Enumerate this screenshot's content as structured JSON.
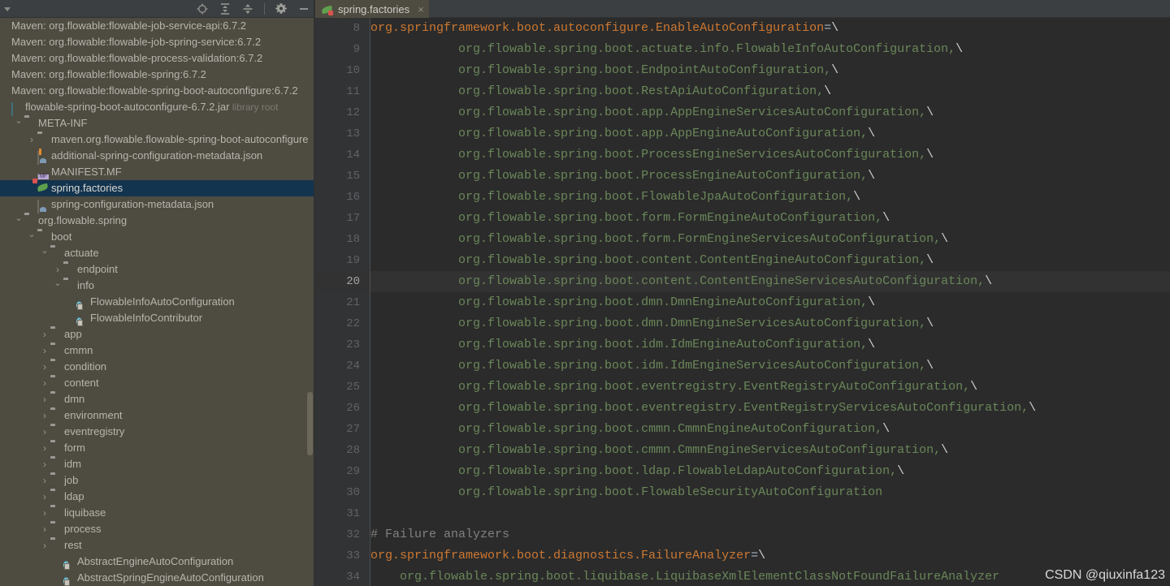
{
  "project_panel": {
    "toolbar": {
      "left_icons": [
        "list-dropdown-icon"
      ],
      "right_icons": [
        "locate-icon",
        "expand-all-icon",
        "collapse-all-icon",
        "gear-icon",
        "minimize-icon"
      ]
    },
    "tree": [
      {
        "depth": 0,
        "label": "Maven: org.flowable:flowable-job-service-api:6.7.2",
        "icon": "",
        "arrow": "",
        "kind": "maven"
      },
      {
        "depth": 0,
        "label": "Maven: org.flowable:flowable-job-spring-service:6.7.2",
        "icon": "",
        "arrow": "",
        "kind": "maven"
      },
      {
        "depth": 0,
        "label": "Maven: org.flowable:flowable-process-validation:6.7.2",
        "icon": "",
        "arrow": "",
        "kind": "maven"
      },
      {
        "depth": 0,
        "label": "Maven: org.flowable:flowable-spring:6.7.2",
        "icon": "",
        "arrow": "",
        "kind": "maven"
      },
      {
        "depth": 0,
        "label": "Maven: org.flowable:flowable-spring-boot-autoconfigure:6.7.2",
        "icon": "",
        "arrow": "",
        "kind": "maven"
      },
      {
        "depth": 0,
        "label": "flowable-spring-boot-autoconfigure-6.7.2.jar",
        "sub": "library root",
        "icon": "jar-icon",
        "arrow": "",
        "kind": "jar"
      },
      {
        "depth": 1,
        "label": "META-INF",
        "icon": "folder-icon",
        "arrow": "v",
        "kind": "folder"
      },
      {
        "depth": 2,
        "label": "maven.org.flowable.flowable-spring-boot-autoconfigure",
        "icon": "folder-icon",
        "arrow": ">",
        "kind": "folder"
      },
      {
        "depth": 2,
        "label": "additional-spring-configuration-metadata.json",
        "icon": "json-orange-icon",
        "arrow": "",
        "kind": "file"
      },
      {
        "depth": 2,
        "label": "MANIFEST.MF",
        "icon": "manifest-icon",
        "arrow": "",
        "kind": "file"
      },
      {
        "depth": 2,
        "label": "spring.factories",
        "icon": "spring-leaf-icon",
        "arrow": "",
        "kind": "file",
        "selected": true
      },
      {
        "depth": 2,
        "label": "spring-configuration-metadata.json",
        "icon": "json-green-icon",
        "arrow": "",
        "kind": "file"
      },
      {
        "depth": 1,
        "label": "org.flowable.spring",
        "icon": "folder-icon",
        "arrow": "v",
        "kind": "folder"
      },
      {
        "depth": 2,
        "label": "boot",
        "icon": "folder-icon",
        "arrow": "v",
        "kind": "folder"
      },
      {
        "depth": 3,
        "label": "actuate",
        "icon": "folder-icon",
        "arrow": "v",
        "kind": "folder"
      },
      {
        "depth": 4,
        "label": "endpoint",
        "icon": "folder-icon",
        "arrow": ">",
        "kind": "folder"
      },
      {
        "depth": 4,
        "label": "info",
        "icon": "folder-icon",
        "arrow": "v",
        "kind": "folder"
      },
      {
        "depth": 5,
        "label": "FlowableInfoAutoConfiguration",
        "icon": "class-icon",
        "arrow": "",
        "kind": "class"
      },
      {
        "depth": 5,
        "label": "FlowableInfoContributor",
        "icon": "class-icon",
        "arrow": "",
        "kind": "class"
      },
      {
        "depth": 3,
        "label": "app",
        "icon": "folder-icon",
        "arrow": ">",
        "kind": "folder"
      },
      {
        "depth": 3,
        "label": "cmmn",
        "icon": "folder-icon",
        "arrow": ">",
        "kind": "folder"
      },
      {
        "depth": 3,
        "label": "condition",
        "icon": "folder-icon",
        "arrow": ">",
        "kind": "folder"
      },
      {
        "depth": 3,
        "label": "content",
        "icon": "folder-icon",
        "arrow": ">",
        "kind": "folder"
      },
      {
        "depth": 3,
        "label": "dmn",
        "icon": "folder-icon",
        "arrow": ">",
        "kind": "folder"
      },
      {
        "depth": 3,
        "label": "environment",
        "icon": "folder-icon",
        "arrow": ">",
        "kind": "folder"
      },
      {
        "depth": 3,
        "label": "eventregistry",
        "icon": "folder-icon",
        "arrow": ">",
        "kind": "folder"
      },
      {
        "depth": 3,
        "label": "form",
        "icon": "folder-icon",
        "arrow": ">",
        "kind": "folder"
      },
      {
        "depth": 3,
        "label": "idm",
        "icon": "folder-icon",
        "arrow": ">",
        "kind": "folder"
      },
      {
        "depth": 3,
        "label": "job",
        "icon": "folder-icon",
        "arrow": ">",
        "kind": "folder"
      },
      {
        "depth": 3,
        "label": "ldap",
        "icon": "folder-icon",
        "arrow": ">",
        "kind": "folder"
      },
      {
        "depth": 3,
        "label": "liquibase",
        "icon": "folder-icon",
        "arrow": ">",
        "kind": "folder"
      },
      {
        "depth": 3,
        "label": "process",
        "icon": "folder-icon",
        "arrow": ">",
        "kind": "folder"
      },
      {
        "depth": 3,
        "label": "rest",
        "icon": "folder-icon",
        "arrow": ">",
        "kind": "folder"
      },
      {
        "depth": 4,
        "label": "AbstractEngineAutoConfiguration",
        "icon": "class-icon",
        "arrow": "",
        "kind": "class"
      },
      {
        "depth": 4,
        "label": "AbstractSpringEngineAutoConfiguration",
        "icon": "class-icon",
        "arrow": "",
        "kind": "class"
      }
    ]
  },
  "editor": {
    "tab": {
      "label": "spring.factories",
      "icon": "spring-leaf-icon",
      "close": "×"
    },
    "current_line": 20,
    "first_line": 8,
    "lines": [
      {
        "n": 8,
        "indent": 0,
        "key": "org.springframework.boot.autoconfigure.EnableAutoConfiguration",
        "eq": "=",
        "cont": "\\"
      },
      {
        "n": 9,
        "indent": 3,
        "val": "org.flowable.spring.boot.actuate.info.FlowableInfoAutoConfiguration,",
        "cont": "\\"
      },
      {
        "n": 10,
        "indent": 3,
        "val": "org.flowable.spring.boot.EndpointAutoConfiguration,",
        "cont": "\\"
      },
      {
        "n": 11,
        "indent": 3,
        "val": "org.flowable.spring.boot.RestApiAutoConfiguration,",
        "cont": "\\"
      },
      {
        "n": 12,
        "indent": 3,
        "val": "org.flowable.spring.boot.app.AppEngineServicesAutoConfiguration,",
        "cont": "\\"
      },
      {
        "n": 13,
        "indent": 3,
        "val": "org.flowable.spring.boot.app.AppEngineAutoConfiguration,",
        "cont": "\\"
      },
      {
        "n": 14,
        "indent": 3,
        "val": "org.flowable.spring.boot.ProcessEngineServicesAutoConfiguration,",
        "cont": "\\"
      },
      {
        "n": 15,
        "indent": 3,
        "val": "org.flowable.spring.boot.ProcessEngineAutoConfiguration,",
        "cont": "\\"
      },
      {
        "n": 16,
        "indent": 3,
        "val": "org.flowable.spring.boot.FlowableJpaAutoConfiguration,",
        "cont": "\\"
      },
      {
        "n": 17,
        "indent": 3,
        "val": "org.flowable.spring.boot.form.FormEngineAutoConfiguration,",
        "cont": "\\"
      },
      {
        "n": 18,
        "indent": 3,
        "val": "org.flowable.spring.boot.form.FormEngineServicesAutoConfiguration,",
        "cont": "\\"
      },
      {
        "n": 19,
        "indent": 3,
        "val": "org.flowable.spring.boot.content.ContentEngineAutoConfiguration,",
        "cont": "\\"
      },
      {
        "n": 20,
        "indent": 3,
        "val": "org.flowable.spring.boot.content.ContentEngineServicesAutoConfiguration,",
        "cont": "\\",
        "current": true
      },
      {
        "n": 21,
        "indent": 3,
        "val": "org.flowable.spring.boot.dmn.DmnEngineAutoConfiguration,",
        "cont": "\\"
      },
      {
        "n": 22,
        "indent": 3,
        "val": "org.flowable.spring.boot.dmn.DmnEngineServicesAutoConfiguration,",
        "cont": "\\"
      },
      {
        "n": 23,
        "indent": 3,
        "val": "org.flowable.spring.boot.idm.IdmEngineAutoConfiguration,",
        "cont": "\\"
      },
      {
        "n": 24,
        "indent": 3,
        "val": "org.flowable.spring.boot.idm.IdmEngineServicesAutoConfiguration,",
        "cont": "\\"
      },
      {
        "n": 25,
        "indent": 3,
        "val": "org.flowable.spring.boot.eventregistry.EventRegistryAutoConfiguration,",
        "cont": "\\"
      },
      {
        "n": 26,
        "indent": 3,
        "val": "org.flowable.spring.boot.eventregistry.EventRegistryServicesAutoConfiguration,",
        "cont": "\\"
      },
      {
        "n": 27,
        "indent": 3,
        "val": "org.flowable.spring.boot.cmmn.CmmnEngineAutoConfiguration,",
        "cont": "\\"
      },
      {
        "n": 28,
        "indent": 3,
        "val": "org.flowable.spring.boot.cmmn.CmmnEngineServicesAutoConfiguration,",
        "cont": "\\"
      },
      {
        "n": 29,
        "indent": 3,
        "val": "org.flowable.spring.boot.ldap.FlowableLdapAutoConfiguration,",
        "cont": "\\"
      },
      {
        "n": 30,
        "indent": 3,
        "val": "org.flowable.spring.boot.FlowableSecurityAutoConfiguration",
        "cont": ""
      },
      {
        "n": 31,
        "indent": 0,
        "val": "",
        "cont": ""
      },
      {
        "n": 32,
        "indent": 0,
        "comment": "# Failure analyzers"
      },
      {
        "n": 33,
        "indent": 0,
        "key": "org.springframework.boot.diagnostics.FailureAnalyzer",
        "eq": "=",
        "cont": "\\"
      },
      {
        "n": 34,
        "indent": 1,
        "val": "org.flowable.spring.boot.liquibase.LiquibaseXmlElementClassNotFoundFailureAnalyzer",
        "cont": ""
      }
    ]
  },
  "watermark": "CSDN @qiuxinfa123",
  "colors": {
    "panel_bg": "#4e4b41",
    "editor_bg": "#2b2b2b",
    "gutter_bg": "#313335",
    "toolbar_bg": "#3c3f41",
    "selection_bg": "#13344f",
    "current_line_bg": "#323232",
    "key_color": "#cc7832",
    "value_color": "#6a8759",
    "comment_color": "#808080",
    "text_color": "#a9b7c6"
  }
}
